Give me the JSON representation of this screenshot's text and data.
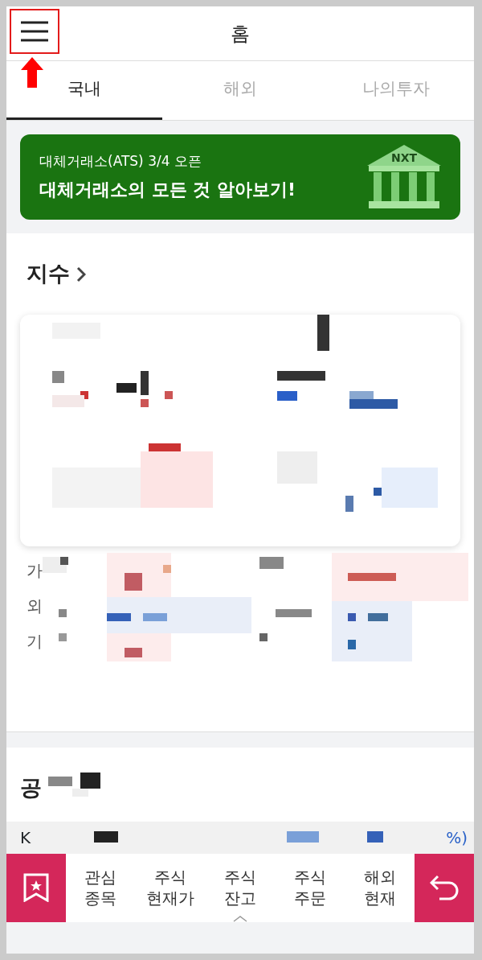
{
  "header": {
    "title": "홈"
  },
  "tabs": [
    {
      "label": "국내",
      "selected": true
    },
    {
      "label": "해외",
      "selected": false
    },
    {
      "label": "나의투자",
      "selected": false
    }
  ],
  "banner": {
    "subtitle": "대체거래소(ATS) 3/4 오픈",
    "title": "대체거래소의 모든 것 알아보기!",
    "logo_text": "NXT"
  },
  "index_section": {
    "title": "지수",
    "row_labels": [
      "가",
      "외",
      "기"
    ]
  },
  "second_section": {
    "title": "공"
  },
  "ticker": {
    "name": "K",
    "tail": "%)"
  },
  "bottom_nav": {
    "items": [
      {
        "lines": [
          "관심",
          "종목"
        ]
      },
      {
        "lines": [
          "주식",
          "현재가"
        ]
      },
      {
        "lines": [
          "주식",
          "잔고"
        ]
      },
      {
        "lines": [
          "주식",
          "주문"
        ]
      },
      {
        "lines": [
          "해외",
          "현재"
        ]
      }
    ]
  }
}
